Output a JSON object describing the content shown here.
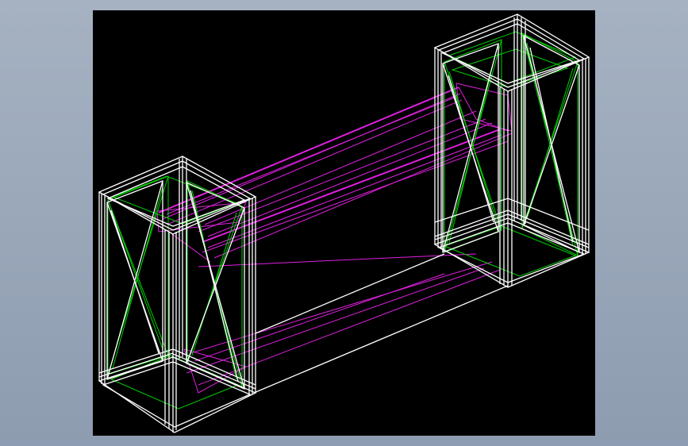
{
  "viewport": {
    "background_color": "#000000",
    "page_background": "#97a5b8"
  },
  "colors": {
    "frame": "#ffffff",
    "cross_braces": "#00e000",
    "bridge": "#e020e0"
  },
  "objects": [
    {
      "name": "left-cabinet",
      "type": "wireframe-box"
    },
    {
      "name": "right-cabinet",
      "type": "wireframe-box"
    },
    {
      "name": "connecting-duct",
      "type": "wireframe-prism"
    }
  ]
}
